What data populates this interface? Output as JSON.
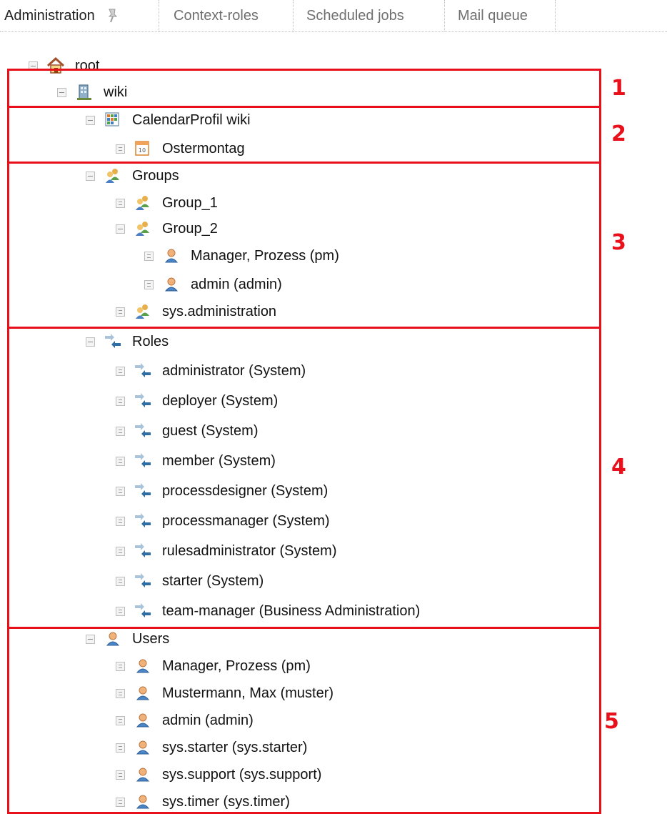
{
  "tabs": [
    {
      "label": "Administration"
    },
    {
      "label": "Context-roles"
    },
    {
      "label": "Scheduled jobs"
    },
    {
      "label": "Mail queue"
    }
  ],
  "tree": {
    "root": {
      "label": "root",
      "icon": "home-icon"
    },
    "wiki": {
      "label": "wiki",
      "icon": "building-icon"
    },
    "calendar": {
      "label": "CalendarProfil wiki",
      "icon": "calendar-grid-icon",
      "children": [
        "Ostermontag"
      ]
    },
    "groups": {
      "label": "Groups",
      "icon": "group-icon",
      "children": [
        "Group_1",
        "Group_2",
        "sys.administration"
      ],
      "group2_members": [
        "Manager, Prozess (pm)",
        "admin (admin)"
      ]
    },
    "roles": {
      "label": "Roles",
      "icon": "role-arrows-icon",
      "children": [
        "administrator (System)",
        "deployer (System)",
        "guest (System)",
        "member (System)",
        "processdesigner (System)",
        "processmanager (System)",
        "rulesadministrator (System)",
        "starter (System)",
        "team-manager (Business Administration)"
      ]
    },
    "users": {
      "label": "Users",
      "icon": "user-icon",
      "children": [
        "Manager, Prozess (pm)",
        "Mustermann, Max (muster)",
        "admin (admin)",
        "sys.starter (sys.starter)",
        "sys.support (sys.support)",
        "sys.timer (sys.timer)"
      ]
    }
  },
  "annotations": [
    "1",
    "2",
    "3",
    "4",
    "5"
  ],
  "colors": {
    "annotation": "#e8101a",
    "tab_inactive": "#6f6f6f"
  }
}
